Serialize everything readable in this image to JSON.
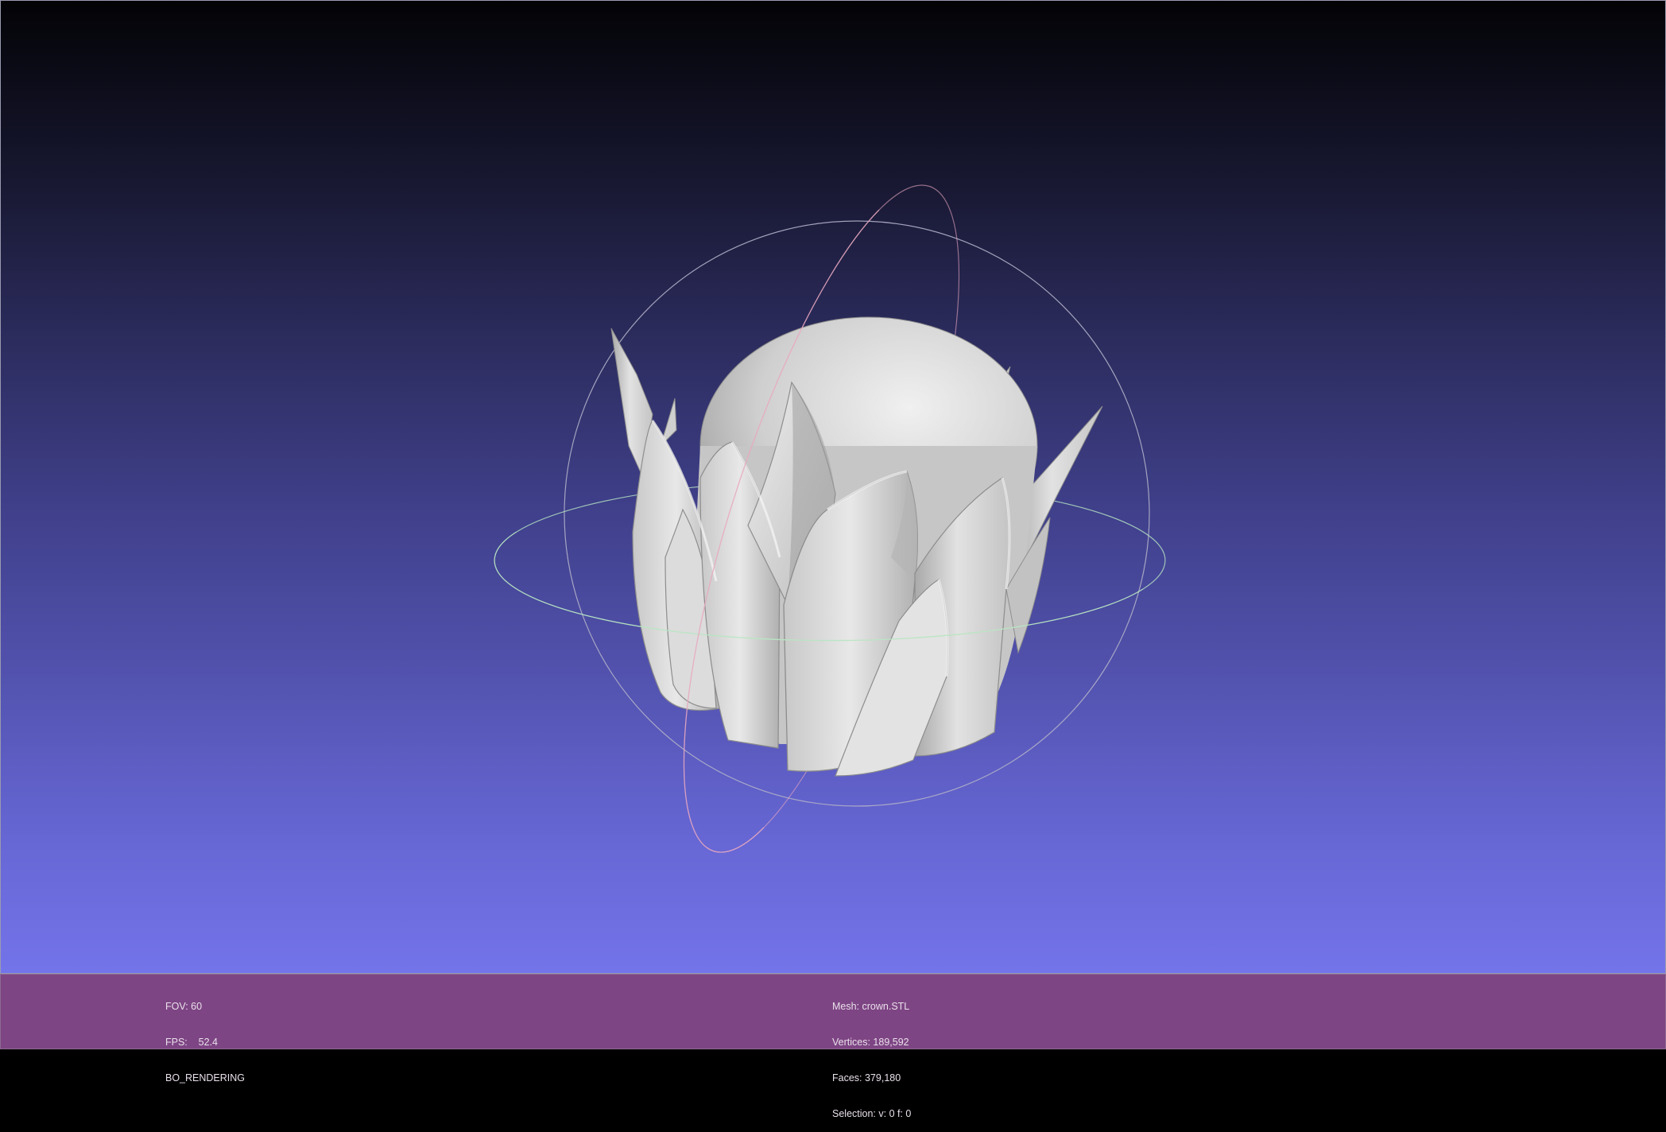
{
  "viewer": {
    "left_info": {
      "fov": "FOV: 60",
      "fps": "FPS:    52.4",
      "mode": "BO_RENDERING"
    },
    "mesh_info": {
      "mesh": "Mesh: crown.STL",
      "vertices": "Vertices: 189,592",
      "faces": "Faces: 379,180",
      "selection": "Selection: v: 0 f: 0"
    }
  },
  "colors": {
    "background_top": "#030306",
    "background_bottom": "#7474ea",
    "status_bar": "#7e4584",
    "mesh": "#d8d8d8",
    "trackball_horizontal": "#b8e6c2",
    "trackball_vertical": "#e8a8c0",
    "trackball_outer": "#b0b0c8"
  },
  "icons": {
    "trackball": "trackball-gizmo-icon"
  }
}
